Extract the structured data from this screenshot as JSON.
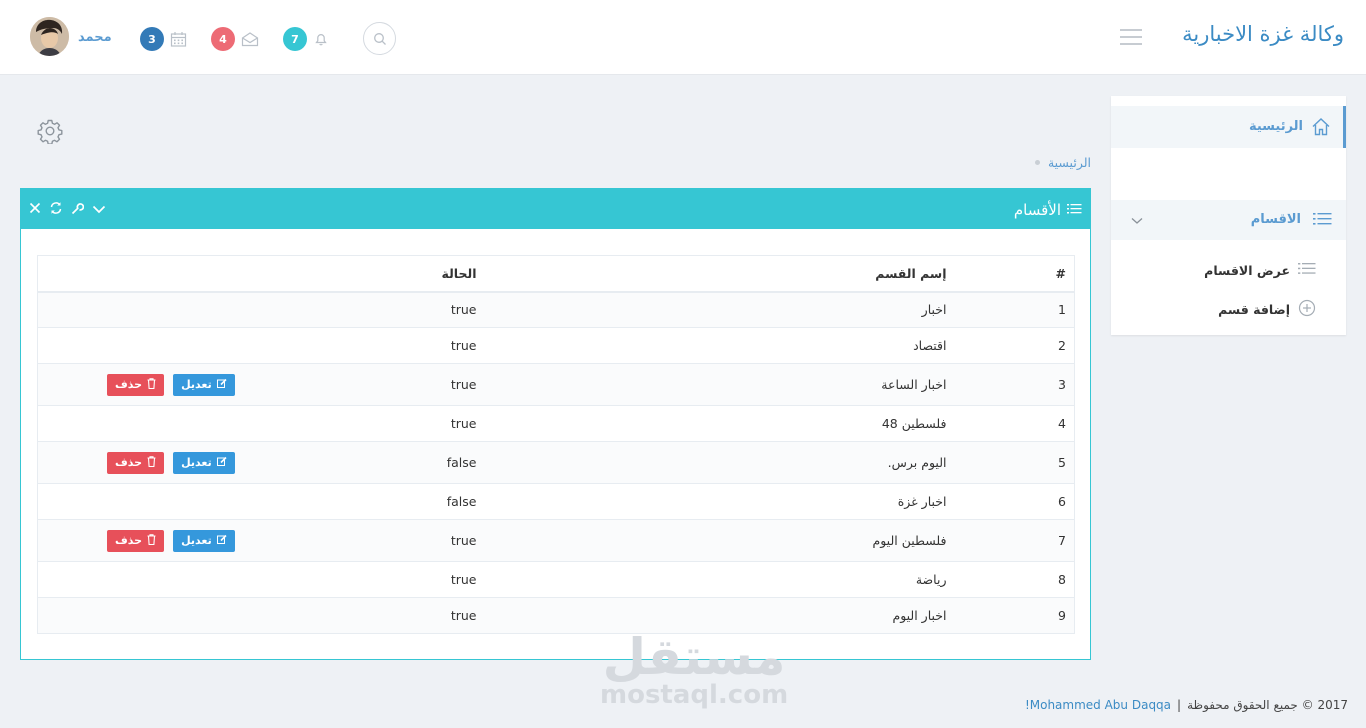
{
  "header": {
    "brand": "وكالة غزة الاخبارية",
    "user_name": "محمد",
    "badges": {
      "calendar": "3",
      "mail": "4",
      "bell": "7"
    },
    "colors": {
      "calendar": "#337ab7",
      "mail": "#ed6b75",
      "bell": "#36c6d3"
    }
  },
  "sidebar": {
    "home": "الرئيسية",
    "sections": "الاقسام",
    "sub_items": [
      "عرض الاقسام",
      "إضافة قسم"
    ]
  },
  "breadcrumb": {
    "home": "الرئيسية"
  },
  "portlet": {
    "title": "الأقسام",
    "accent": "#36c6d3"
  },
  "table": {
    "headers": {
      "num": "#",
      "name": "إسم القسم",
      "status": "الحالة"
    },
    "rows": [
      {
        "num": "1",
        "name": "اخبار",
        "status": "true",
        "actions": false
      },
      {
        "num": "2",
        "name": "اقتصاد",
        "status": "true",
        "actions": false
      },
      {
        "num": "3",
        "name": "اخبار الساعة",
        "status": "true",
        "actions": true
      },
      {
        "num": "4",
        "name": "فلسطين 48",
        "status": "true",
        "actions": false
      },
      {
        "num": "5",
        "name": "اليوم برس.",
        "status": "false",
        "actions": true
      },
      {
        "num": "6",
        "name": "اخبار غزة",
        "status": "false",
        "actions": false
      },
      {
        "num": "7",
        "name": "فلسطين اليوم",
        "status": "true",
        "actions": true
      },
      {
        "num": "8",
        "name": "رياضة",
        "status": "true",
        "actions": false
      },
      {
        "num": "9",
        "name": "اخبار اليوم",
        "status": "true",
        "actions": false
      }
    ],
    "edit_label": "تعديل",
    "delete_label": "حذف"
  },
  "footer": {
    "copyright": "2017 © جميع الحقوق محفوظة",
    "separator": "|",
    "author": "Mohammed Abu Daqqa!"
  },
  "watermark": {
    "ar": "مستقل",
    "en": "mostaql.com"
  }
}
